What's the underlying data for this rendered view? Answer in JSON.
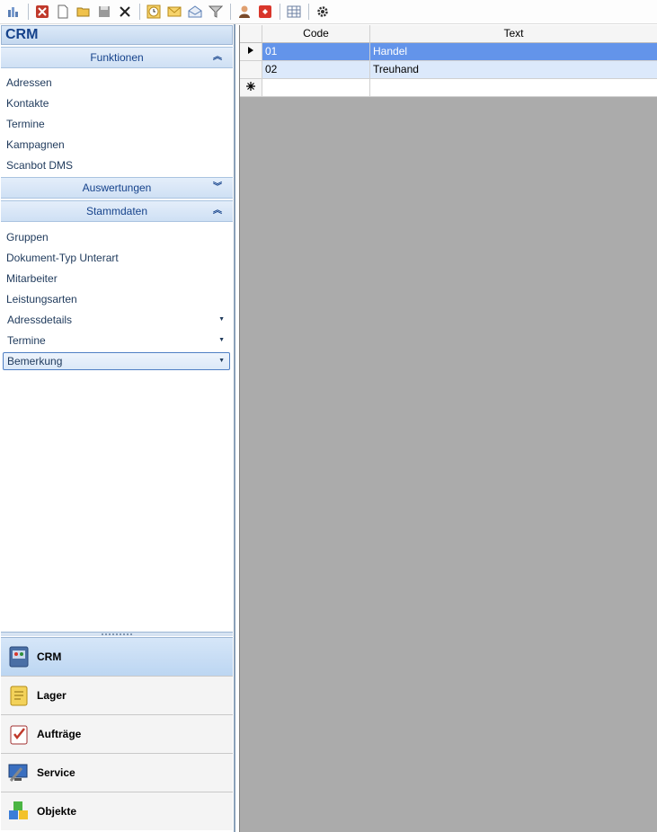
{
  "toolbar": {
    "buttons": [
      "chart-icon",
      "delete-red-icon",
      "new-document-icon",
      "open-folder-icon",
      "save-icon",
      "close-x-icon",
      "clock-icon",
      "email-icon",
      "mail-open-icon",
      "filter-icon",
      "person-icon",
      "red-tag-icon",
      "table-grid-icon",
      "gear-icon"
    ]
  },
  "nav": {
    "title": "CRM",
    "groups": {
      "funktionen": {
        "label": "Funktionen",
        "items": [
          "Adressen",
          "Kontakte",
          "Termine",
          "Kampagnen",
          "Scanbot DMS"
        ]
      },
      "auswertungen": {
        "label": "Auswertungen"
      },
      "stammdaten": {
        "label": "Stammdaten",
        "items": [
          "Gruppen",
          "Dokument-Typ Unterart",
          "Mitarbeiter",
          "Leistungsarten"
        ],
        "dropdown_items": [
          "Adressdetails",
          "Termine",
          "Bemerkung"
        ]
      }
    },
    "modules": [
      "CRM",
      "Lager",
      "Aufträge",
      "Service",
      "Objekte"
    ]
  },
  "grid": {
    "columns": [
      "Code",
      "Text"
    ],
    "rows": [
      {
        "code": "01",
        "text": "Handel"
      },
      {
        "code": "02",
        "text": "Treuhand"
      }
    ]
  },
  "colors": {
    "selection": "#6394ea",
    "alt_row": "#dce9fb",
    "header_blue": "#15428b",
    "background_gray": "#ababab"
  }
}
